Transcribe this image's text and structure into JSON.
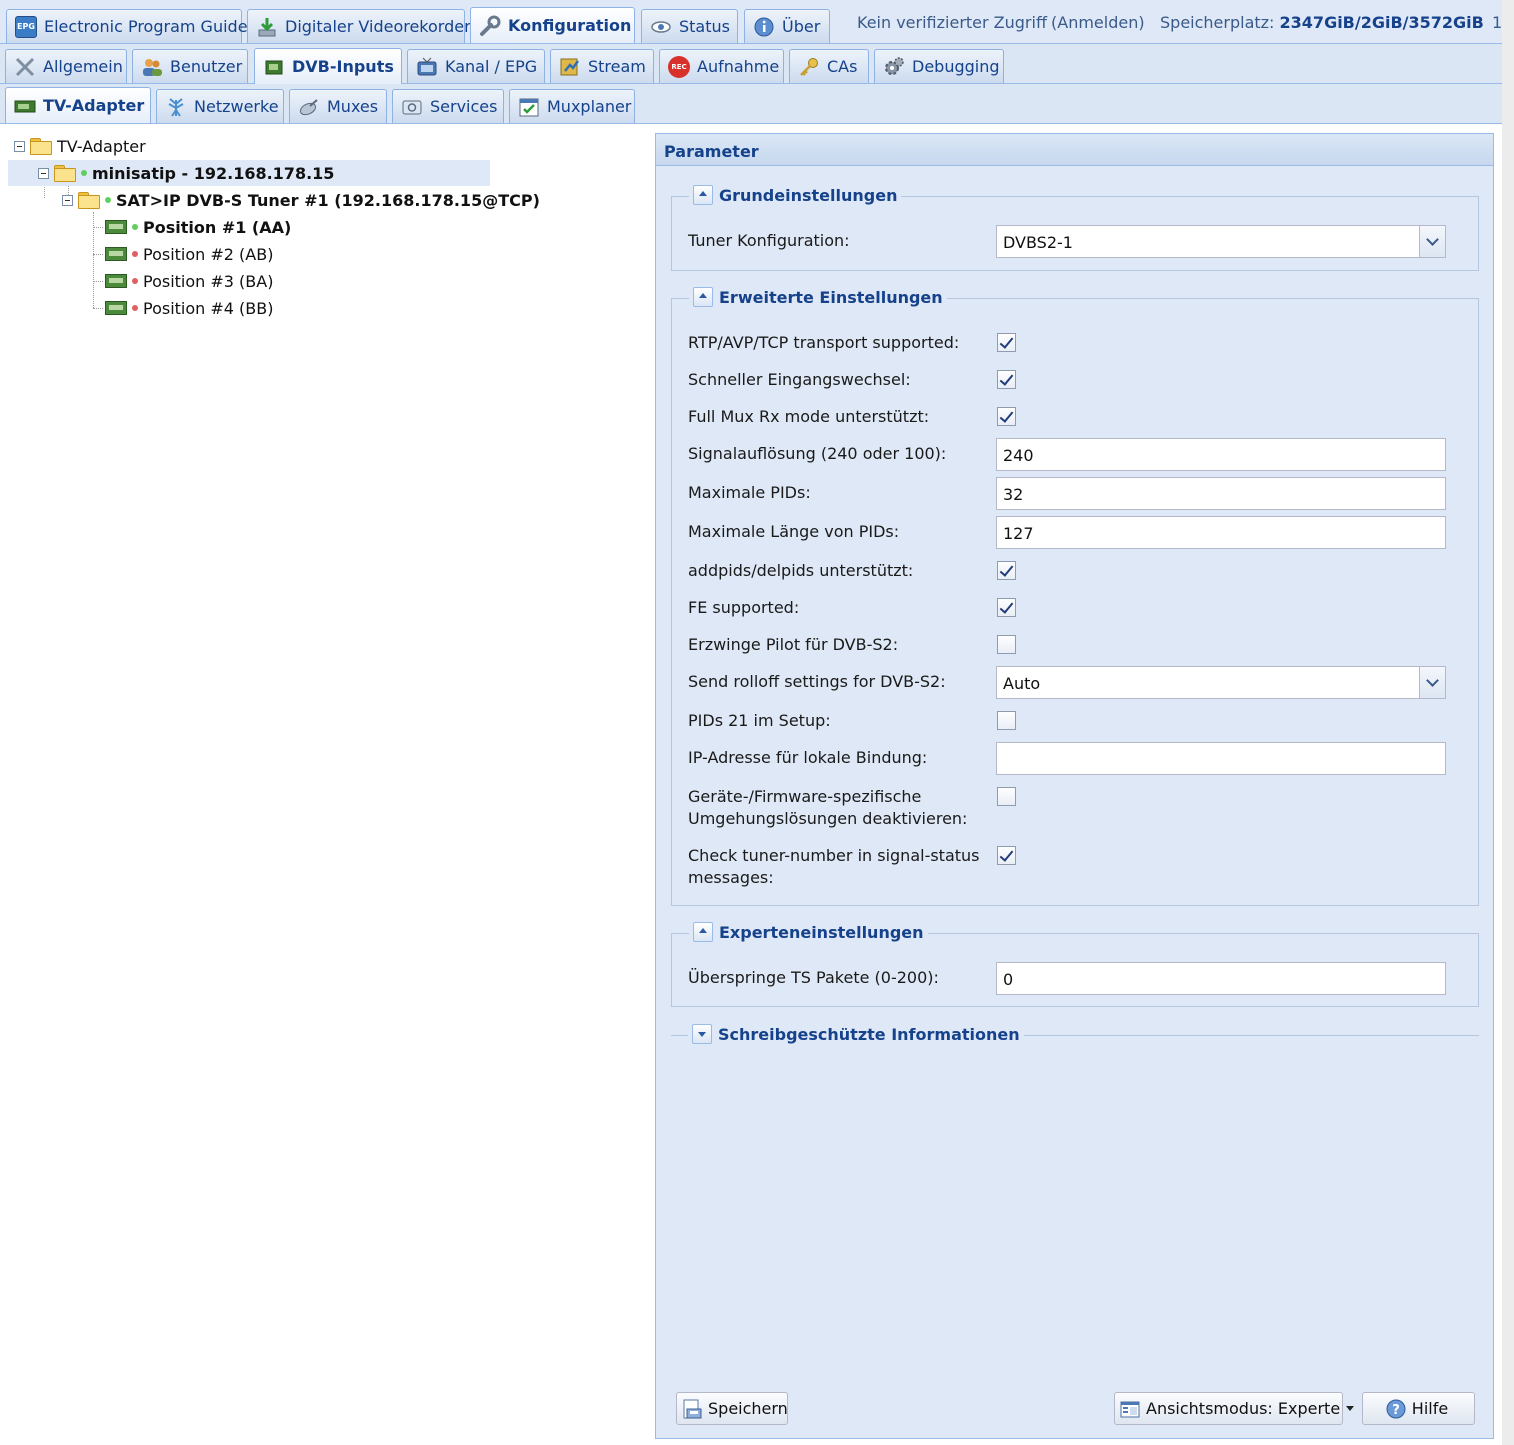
{
  "topnav": {
    "tabs": [
      {
        "label": "Electronic Program Guide"
      },
      {
        "label": "Digitaler Videorekorder"
      },
      {
        "label": "Konfiguration"
      },
      {
        "label": "Status"
      },
      {
        "label": "Über"
      }
    ],
    "access": "Kein verifizierter Zugriff",
    "login": "(Anmelden)",
    "storage_label": "Speicherplatz:",
    "storage_value": "2347GiB/2GiB/3572GiB",
    "overflow": "1"
  },
  "config_tabs": [
    {
      "label": "Allgemein"
    },
    {
      "label": "Benutzer"
    },
    {
      "label": "DVB-Inputs"
    },
    {
      "label": "Kanal / EPG"
    },
    {
      "label": "Stream"
    },
    {
      "label": "Aufnahme"
    },
    {
      "label": "CAs"
    },
    {
      "label": "Debugging"
    }
  ],
  "dvb_tabs": [
    {
      "label": "TV-Adapter"
    },
    {
      "label": "Netzwerke"
    },
    {
      "label": "Muxes"
    },
    {
      "label": "Services"
    },
    {
      "label": "Muxplaner"
    }
  ],
  "tree": {
    "root": "TV-Adapter",
    "device": "minisatip - 192.168.178.15",
    "tuner": "SAT>IP DVB-S Tuner #1 (192.168.178.15@TCP)",
    "positions": [
      {
        "label": "Position #1 (AA)",
        "status": "green"
      },
      {
        "label": "Position #2 (AB)",
        "status": "red"
      },
      {
        "label": "Position #3 (BA)",
        "status": "red"
      },
      {
        "label": "Position #4 (BB)",
        "status": "red"
      }
    ]
  },
  "panel": {
    "title": "Parameter",
    "basic": {
      "legend": "Grundeinstellungen",
      "tuner_config_label": "Tuner Konfiguration:",
      "tuner_config_value": "DVBS2-1"
    },
    "advanced": {
      "legend": "Erweiterte Einstellungen",
      "rtp_label": "RTP/AVP/TCP transport supported:",
      "rtp_checked": true,
      "fast_switch_label": "Schneller Eingangswechsel:",
      "fast_switch_checked": true,
      "full_mux_label": "Full Mux Rx mode unterstützt:",
      "full_mux_checked": true,
      "signal_res_label": "Signalauflösung (240 oder 100):",
      "signal_res_value": "240",
      "max_pids_label": "Maximale PIDs:",
      "max_pids_value": "32",
      "max_pid_len_label": "Maximale Länge von PIDs:",
      "max_pid_len_value": "127",
      "addpids_label": "addpids/delpids unterstützt:",
      "addpids_checked": true,
      "fe_label": "FE supported:",
      "fe_checked": true,
      "pilot_label": "Erzwinge Pilot für DVB-S2:",
      "pilot_checked": false,
      "rolloff_label": "Send rolloff settings for DVB-S2:",
      "rolloff_value": "Auto",
      "pids21_label": "PIDs 21 im Setup:",
      "pids21_checked": false,
      "ip_bind_label": "IP-Adresse für lokale Bindung:",
      "ip_bind_value": "",
      "workarounds_label": "Geräte-/Firmware-spezifische Umgehungslösungen deaktivieren:",
      "workarounds_checked": false,
      "tuner_number_label": "Check tuner-number in signal-status messages:",
      "tuner_number_checked": true
    },
    "expert": {
      "legend": "Experteneinstellungen",
      "skip_ts_label": "Überspringe TS Pakete (0-200):",
      "skip_ts_value": "0"
    },
    "readonly": {
      "legend": "Schreibgeschützte Informationen"
    },
    "buttons": {
      "save": "Speichern",
      "view_mode": "Ansichtsmodus: Experte",
      "help": "Hilfe"
    }
  },
  "colors": {
    "accent": "#15428b",
    "tab_border": "#8db2e3",
    "panel_bg": "#dfe8f6",
    "selected_row": "#dfe8f6",
    "status_green": "#5fcf5f",
    "status_red": "#e06060"
  },
  "icons": {
    "epg": "epg-icon",
    "dvr": "download-icon",
    "config": "wrench-icon",
    "status": "eye-icon",
    "about": "info-icon",
    "general": "tools-icon",
    "users": "users-icon",
    "dvb": "tv-card-icon",
    "channel": "tv-icon",
    "stream": "stream-icon",
    "recording": "rec-icon",
    "cas": "key-icon",
    "debug": "cog-icon",
    "networks": "antenna-icon",
    "muxes": "satellite-icon",
    "services": "services-icon",
    "muxplaner": "calendar-icon",
    "save": "save-icon",
    "view_mode": "view-mode-icon",
    "help": "help-icon"
  }
}
